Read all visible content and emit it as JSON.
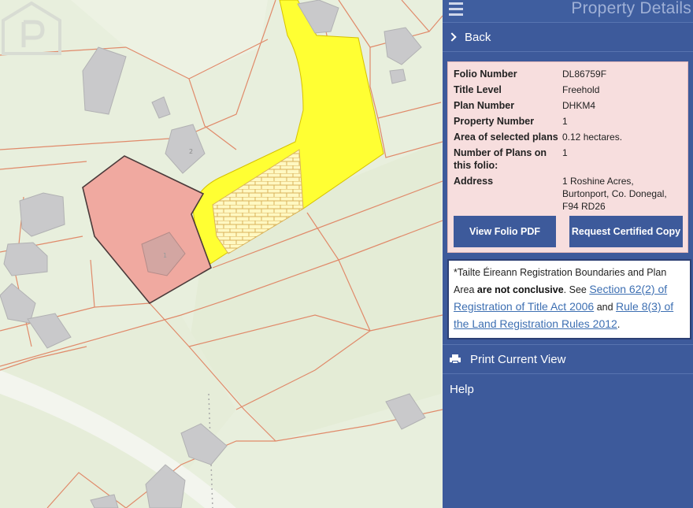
{
  "panel": {
    "title": "Property Details",
    "back_label": "Back"
  },
  "details": {
    "rows": [
      {
        "label": "Folio Number",
        "value": "DL86759F"
      },
      {
        "label": "Title Level",
        "value": "Freehold"
      },
      {
        "label": "Plan Number",
        "value": "DHKM4"
      },
      {
        "label": "Property Number",
        "value": "1"
      },
      {
        "label": "Area of selected plans",
        "value": "0.12 hectares."
      },
      {
        "label": "Number of Plans on this folio:",
        "value": "1"
      },
      {
        "label": "Address",
        "value": "1 Roshine Acres, Burtonport, Co. Donegal, F94 RD26"
      }
    ],
    "view_pdf_label": "View Folio PDF",
    "request_copy_label": "Request Certified Copy"
  },
  "notice": {
    "text_before": "*Tailte Éireann Registration Boundaries and Plan Area ",
    "bold": "are not conclusive",
    "text_mid": ". See ",
    "link1": "Section 62(2) of Registration of Title Act 2006",
    "text_and": " and ",
    "link2": "Rule 8(3) of the Land Registration Rules 2012",
    "text_end": "."
  },
  "actions": {
    "print_label": "Print Current View",
    "help_label": "Help"
  },
  "map": {
    "house_labels": [
      "2",
      "1"
    ],
    "colors": {
      "selected_plot": "#f0a9a0",
      "road": "#ffff33",
      "boundary": "#e08a6a"
    }
  }
}
